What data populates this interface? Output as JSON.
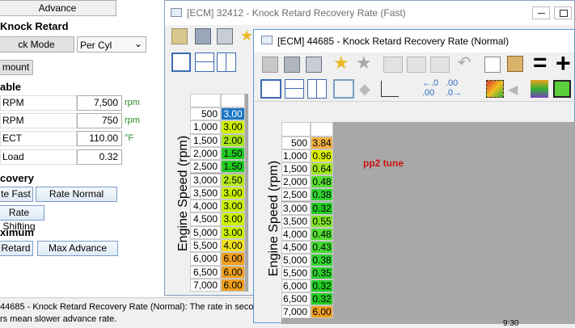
{
  "left_panel": {
    "tab_label": "Advance",
    "section_knock_retard": "Knock Retard",
    "knock_mode_label": "ck Mode",
    "knock_mode_value": "Per Cyl",
    "amount_btn": "mount",
    "section_enable": "able",
    "rows": [
      {
        "label": "RPM",
        "value": "7,500",
        "unit": "rpm"
      },
      {
        "label": "RPM",
        "value": "750",
        "unit": "rpm"
      },
      {
        "label": "ECT",
        "value": "110.00",
        "unit": "°F"
      },
      {
        "label": "Load",
        "value": "0.32",
        "unit": ""
      }
    ],
    "section_recovery": "covery",
    "rate_fast_btn": "te Fast",
    "rate_normal_btn": "Rate Normal",
    "rate_shifting_btn": "Rate Shifting",
    "section_maximum": "ximum",
    "retard_btn": "Retard",
    "max_advance_btn": "Max Advance"
  },
  "status": {
    "line1": "44685 - Knock Retard Recovery Rate (Normal): The rate in second",
    "line2": "rs mean slower advance rate."
  },
  "win_fast": {
    "title": "[ECM] 32412 - Knock Retard Recovery Rate (Fast)",
    "axis_label": "Engine Speed (rpm)",
    "rows": [
      {
        "rpm": "500",
        "val": "3.00",
        "color": "#1c77c7",
        "text": "#ffffff"
      },
      {
        "rpm": "1,000",
        "val": "3.00",
        "color": "#ccf000",
        "text": "#000000"
      },
      {
        "rpm": "1,500",
        "val": "2.00",
        "color": "#a8e61c",
        "text": "#000000"
      },
      {
        "rpm": "2,000",
        "val": "1.50",
        "color": "#22cc22",
        "text": "#000000"
      },
      {
        "rpm": "2,500",
        "val": "1.50",
        "color": "#22cc22",
        "text": "#000000"
      },
      {
        "rpm": "3,000",
        "val": "2.50",
        "color": "#b4ea1a",
        "text": "#000000"
      },
      {
        "rpm": "3,500",
        "val": "3.00",
        "color": "#ccf000",
        "text": "#000000"
      },
      {
        "rpm": "4,000",
        "val": "3.00",
        "color": "#ccf000",
        "text": "#000000"
      },
      {
        "rpm": "4,500",
        "val": "3.00",
        "color": "#ccf000",
        "text": "#000000"
      },
      {
        "rpm": "5,000",
        "val": "3.00",
        "color": "#ccf000",
        "text": "#000000"
      },
      {
        "rpm": "5,500",
        "val": "4.00",
        "color": "#f0e020",
        "text": "#000000"
      },
      {
        "rpm": "6,000",
        "val": "6.00",
        "color": "#f0a020",
        "text": "#000000"
      },
      {
        "rpm": "6,500",
        "val": "6.00",
        "color": "#f0a020",
        "text": "#000000"
      },
      {
        "rpm": "7,000",
        "val": "6.00",
        "color": "#f0a020",
        "text": "#000000"
      }
    ]
  },
  "win_normal": {
    "title": "[ECM] 44685 - Knock Retard Recovery Rate (Normal)",
    "axis_label": "Engine Speed (rpm)",
    "note": "pp2 tune",
    "note_color": "#cc1111",
    "rows": [
      {
        "rpm": "500",
        "val": "3.84",
        "color": "#f0b040"
      },
      {
        "rpm": "1,000",
        "val": "0.96",
        "color": "#ddf200"
      },
      {
        "rpm": "1,500",
        "val": "0.64",
        "color": "#9ee81e"
      },
      {
        "rpm": "2,000",
        "val": "0.48",
        "color": "#55dd33"
      },
      {
        "rpm": "2,500",
        "val": "0.38",
        "color": "#33d433"
      },
      {
        "rpm": "3,000",
        "val": "0.32",
        "color": "#22cc22"
      },
      {
        "rpm": "3,500",
        "val": "0.55",
        "color": "#7ee226"
      },
      {
        "rpm": "4,000",
        "val": "0.48",
        "color": "#55dd33"
      },
      {
        "rpm": "4,500",
        "val": "0.43",
        "color": "#44d833"
      },
      {
        "rpm": "5,000",
        "val": "0.38",
        "color": "#33d433"
      },
      {
        "rpm": "5,500",
        "val": "0.35",
        "color": "#2ccf2c"
      },
      {
        "rpm": "6,000",
        "val": "0.32",
        "color": "#22cc22"
      },
      {
        "rpm": "6,500",
        "val": "0.32",
        "color": "#22cc22"
      },
      {
        "rpm": "7,000",
        "val": "6.00",
        "color": "#f0a020"
      }
    ]
  },
  "clock_fragment": "9:30"
}
